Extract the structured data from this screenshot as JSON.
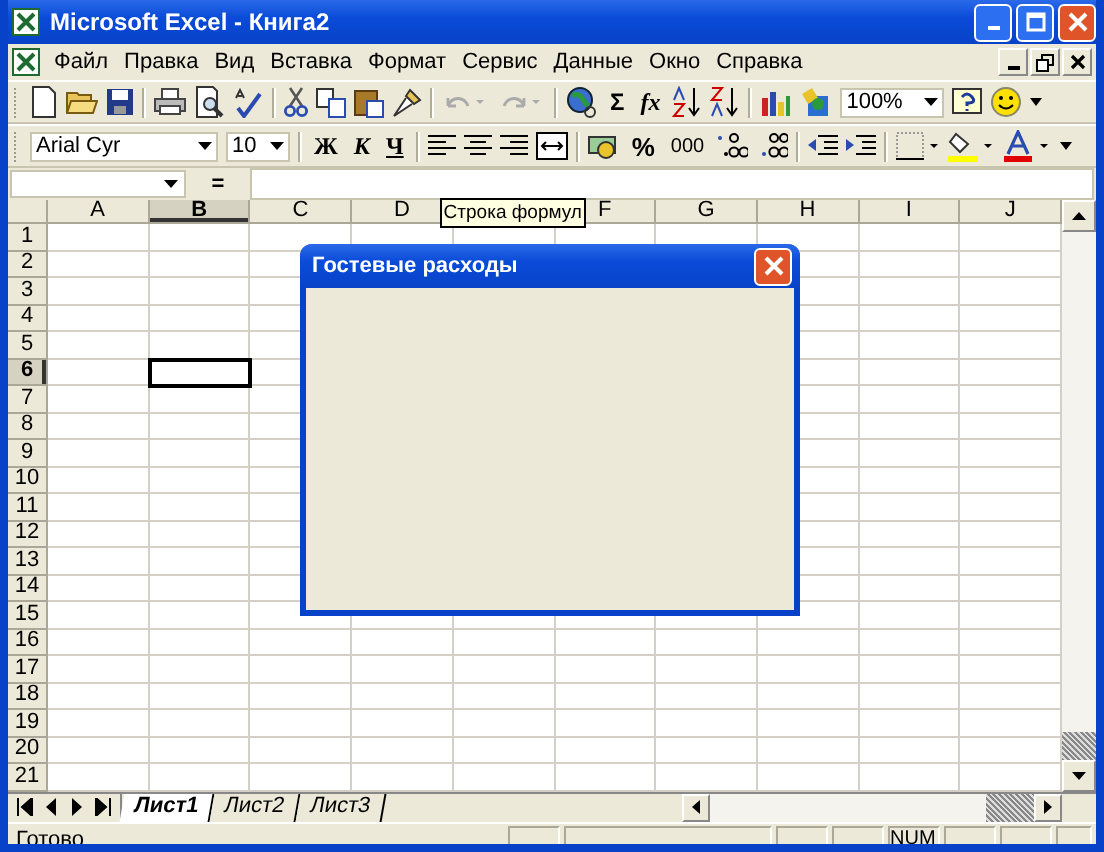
{
  "window": {
    "title": "Microsoft Excel - Книга2"
  },
  "menu": [
    {
      "label": "Файл"
    },
    {
      "label": "Правка"
    },
    {
      "label": "Вид"
    },
    {
      "label": "Вставка"
    },
    {
      "label": "Формат"
    },
    {
      "label": "Сервис"
    },
    {
      "label": "Данные"
    },
    {
      "label": "Окно"
    },
    {
      "label": "Справка"
    }
  ],
  "standard_toolbar": {
    "undo_disabled": true,
    "sum": "Σ",
    "function": "fx",
    "zoom": "100%"
  },
  "formatting_toolbar": {
    "font": "Arial Cyr",
    "size": "10",
    "bold": "Ж",
    "italic": "К",
    "underline": "Ч",
    "percent": "%",
    "thousands": "000"
  },
  "formula_bar": {
    "equals": "=",
    "tooltip": "Строка формул"
  },
  "columns": [
    {
      "label": "A",
      "selected": false
    },
    {
      "label": "B",
      "selected": true
    },
    {
      "label": "C",
      "selected": false
    },
    {
      "label": "D",
      "selected": false
    },
    {
      "kind": "covered"
    },
    {
      "label": "F",
      "selected": false
    },
    {
      "label": "G",
      "selected": false
    },
    {
      "label": "H",
      "selected": false
    },
    {
      "label": "I",
      "selected": false
    },
    {
      "label": "J",
      "selected": false
    }
  ],
  "rows": [
    {
      "label": "1",
      "selected": false
    },
    {
      "label": "2",
      "selected": false
    },
    {
      "label": "3",
      "selected": false
    },
    {
      "label": "4",
      "selected": false
    },
    {
      "label": "5",
      "selected": false
    },
    {
      "label": "6",
      "selected": true
    },
    {
      "label": "7",
      "selected": false
    },
    {
      "label": "8",
      "selected": false
    },
    {
      "label": "9",
      "selected": false
    },
    {
      "label": "10",
      "selected": false
    },
    {
      "label": "11",
      "selected": false
    },
    {
      "label": "12",
      "selected": false
    },
    {
      "label": "13",
      "selected": false
    },
    {
      "label": "14",
      "selected": false
    },
    {
      "label": "15",
      "selected": false
    },
    {
      "label": "16",
      "selected": false
    },
    {
      "label": "17",
      "selected": false
    },
    {
      "label": "18",
      "selected": false
    },
    {
      "label": "19",
      "selected": false
    },
    {
      "label": "20",
      "selected": false
    },
    {
      "label": "21",
      "selected": false
    }
  ],
  "dialog": {
    "title": "Гостевые расходы"
  },
  "sheet_tabs": [
    {
      "label": "Лист1",
      "selected": true
    },
    {
      "label": "Лист2",
      "selected": false
    },
    {
      "label": "Лист3",
      "selected": false
    }
  ],
  "status_bar": {
    "text": "Готово",
    "num": "NUM"
  }
}
